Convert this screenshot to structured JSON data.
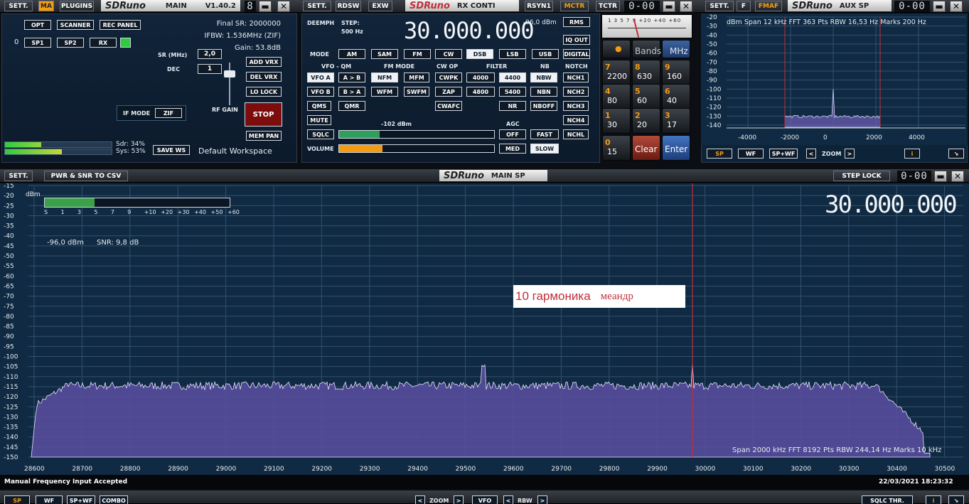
{
  "main_window": {
    "settings_label": "SETT.",
    "ma_label": "MA",
    "plugins_label": "PLUGINS",
    "logo": "SDRuno",
    "title": "MAIN",
    "version": "V1.40.2",
    "seg_value": "8",
    "minimize_label": "▬",
    "close_label": "✕",
    "opt_label": "OPT",
    "scanner_label": "SCANNER",
    "rec_panel_label": "REC PANEL",
    "device_index": "0",
    "sp1_label": "SP1",
    "sp2_label": "SP2",
    "rx_label": "RX",
    "final_sr": "Final SR: 2000000",
    "ifbw": "IFBW: 1.536MHz (ZIF)",
    "gain": "Gain: 53.8dB",
    "sr_label": "SR (MHz)",
    "sr_value": "2,0",
    "dec_label": "DEC",
    "dec_value": "1",
    "add_vrx_label": "ADD VRX",
    "del_vrx_label": "DEL VRX",
    "lo_lock_label": "LO LOCK",
    "if_mode_label": "IF MODE",
    "if_mode_value": "ZIF",
    "rf_gain_label": "RF GAIN",
    "stop_label": "STOP",
    "mem_pan_label": "MEM PAN",
    "sdr_usage": "Sdr: 34%",
    "sys_usage": "Sys: 53%",
    "sdr_pct": 34,
    "sys_pct": 53,
    "save_ws_label": "SAVE WS",
    "workspace": "Default Workspace"
  },
  "rx_control": {
    "settings_label": "SETT.",
    "rdsw_label": "RDSW",
    "exw_label": "EXW",
    "logo": "SDRuno",
    "title": "RX CONTI",
    "rsyn1_label": "RSYN1",
    "mctr_label": "MCTR",
    "tctr_label": "TCTR",
    "seg_value": "0-00",
    "deemph_label": "DEEMPH",
    "step_label": "STEP:",
    "step_value": "500 Hz",
    "frequency": "30.000.000",
    "dbm_readout": "-96,0 dBm",
    "rms_label": "RMS",
    "iq_out_label": "IQ OUT",
    "digital_label": "DIGITAL",
    "mode_label": "MODE",
    "modes": [
      "AM",
      "SAM",
      "FM",
      "CW",
      "DSB",
      "LSB",
      "USB"
    ],
    "vfo_qm_label": "VFO - QM",
    "fm_mode_label": "FM MODE",
    "cw_op_label": "CW OP",
    "filter_label": "FILTER",
    "nb_label": "NB",
    "notch_label": "NOTCH",
    "vfo_a_label": "VFO A",
    "a_to_b_label": "A > B",
    "nfm_label": "NFM",
    "mfm_label": "MFM",
    "cwpk_label": "CWPK",
    "f4000_label": "4000",
    "f4400_label": "4400",
    "nbw_label": "NBW",
    "nch1_label": "NCH1",
    "vfo_b_label": "VFO B",
    "b_to_a_label": "B > A",
    "wfm_label": "WFM",
    "swfm_label": "SWFM",
    "zap_label": "ZAP",
    "f4800_label": "4800",
    "f5400_label": "5400",
    "nbn_label": "NBN",
    "nch2_label": "NCH2",
    "qms_label": "QMS",
    "qmr_label": "QMR",
    "cwafc_label": "CWAFC",
    "nr_label": "NR",
    "nboff_label": "NBOFF",
    "nch3_label": "NCH3",
    "mute_label": "MUTE",
    "agc_label": "AGC",
    "nch4_label": "NCH4",
    "sqlc_label": "SQLC",
    "sqlc_level": "-102 dBm",
    "off_label": "OFF",
    "fast_label": "FAST",
    "nchl_label": "NCHL",
    "volume_label": "VOLUME",
    "med_label": "MED",
    "slow_label": "SLOW",
    "sqlc_fill": 0.26,
    "volume_fill": 0.28,
    "meter_scale": "1 3 5 7 9 +20 +40 +60",
    "bands_label": "Bands",
    "mhz_label": "MHz",
    "keypad": [
      {
        "n": "7",
        "v": "2200"
      },
      {
        "n": "8",
        "v": "630"
      },
      {
        "n": "9",
        "v": "160"
      },
      {
        "n": "4",
        "v": "80"
      },
      {
        "n": "5",
        "v": "60"
      },
      {
        "n": "6",
        "v": "40"
      },
      {
        "n": "1",
        "v": "30"
      },
      {
        "n": "2",
        "v": "20"
      },
      {
        "n": "3",
        "v": "17"
      },
      {
        "n": "0",
        "v": "15"
      }
    ],
    "clear_label": "Clear",
    "enter_label": "Enter"
  },
  "aux_sp": {
    "settings_label": "SETT.",
    "f_label": "F",
    "fmaf_label": "FMAF",
    "logo": "SDRuno",
    "title": "AUX SP",
    "seg_value": "0-00",
    "info": "dBm   Span 12 kHz   FFT 363 Pts   RBW 16,53 Hz   Marks 200 Hz",
    "sp_label": "SP",
    "wf_label": "WF",
    "spwf_label": "SP+WF",
    "zoom_label": "ZOOM",
    "info_icon_label": "i",
    "y_ticks": [
      "-20",
      "-30",
      "-40",
      "-50",
      "-60",
      "-70",
      "-80",
      "-90",
      "-100",
      "-110",
      "-120",
      "-130",
      "-140"
    ],
    "x_ticks": [
      "-4000",
      "-2000",
      "0",
      "2000",
      "4000"
    ]
  },
  "main_sp": {
    "settings_label": "SETT.",
    "pwr_csv_label": "PWR & SNR TO CSV",
    "logo": "SDRuno",
    "title": "MAIN SP",
    "step_lock_label": "STEP LOCK",
    "seg_value": "0-00",
    "dbm_label": "dBm",
    "smeter_scale": [
      "S",
      "1",
      "3",
      "5",
      "7",
      "9",
      "+10",
      "+20",
      "+30",
      "+40",
      "+50",
      "+60"
    ],
    "smeter_fill": 0.27,
    "power_readout": "-96,0 dBm",
    "snr_readout": "SNR: 9,8 dB",
    "frequency": "30.000.000",
    "annotation_main": "10 гармоника",
    "annotation_sub": "меандр",
    "info": "Span 2000 kHz   FFT 8192 Pts   RBW 244,14 Hz   Marks 10 kHz",
    "y_ticks": [
      "-15",
      "-20",
      "-25",
      "-30",
      "-35",
      "-40",
      "-45",
      "-50",
      "-55",
      "-60",
      "-65",
      "-70",
      "-75",
      "-80",
      "-85",
      "-90",
      "-95",
      "-100",
      "-105",
      "-110",
      "-115",
      "-120",
      "-125",
      "-130",
      "-135",
      "-140",
      "-145",
      "-150"
    ],
    "x_ticks": [
      "28600",
      "28700",
      "28800",
      "28900",
      "29000",
      "29100",
      "29200",
      "29300",
      "29400",
      "29500",
      "29600",
      "29700",
      "29800",
      "29900",
      "30000",
      "30100",
      "30200",
      "30300",
      "30400",
      "30500"
    ],
    "status_message": "Manual Frequency Input Accepted",
    "datetime": "22/03/2021 18:23:32",
    "sp_label": "SP",
    "wf_label": "WF",
    "spwf_label": "SP+WF",
    "combo_label": "COMBO",
    "zoom_label": "ZOOM",
    "vfo_label": "VFO",
    "rbw_label": "RBW",
    "sqlc_thr_label": "SQLC THR.",
    "info_icon_label": "i"
  },
  "colors": {
    "accent_orange": "#f39c12",
    "spectrum_fill": "#5a4ea0",
    "marker_red": "#c0303a",
    "green_led": "#2ecc40"
  }
}
